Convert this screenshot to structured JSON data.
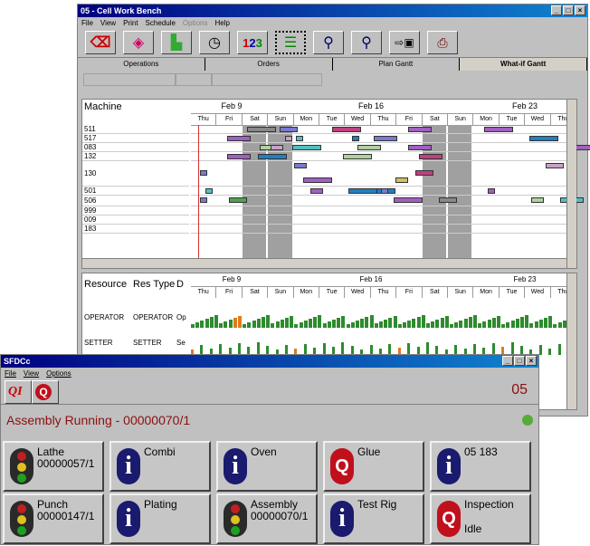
{
  "workbench": {
    "title": "05 - Cell Work Bench",
    "menu": [
      "File",
      "View",
      "Print",
      "Schedule",
      "Options",
      "Help"
    ],
    "tabs": [
      "Operations",
      "Orders",
      "Plan Gantt",
      "What-if Gantt"
    ],
    "header_col": "Machine",
    "weeks": [
      "Feb 9",
      "Feb 16",
      "Feb 23"
    ],
    "days": [
      "Thu",
      "Fri",
      "Sat",
      "Sun",
      "Mon",
      "Tue",
      "Wed",
      "Thu",
      "Fri",
      "Sat",
      "Sun",
      "Mon",
      "Tue",
      "Wed",
      "Thu"
    ],
    "machines": [
      "511",
      "517",
      "083",
      "132",
      "130",
      "501",
      "506",
      "999",
      "009",
      "183"
    ],
    "resource_headers": [
      "Resource",
      "Res Type",
      "D"
    ],
    "resources": [
      {
        "name": "OPERATOR",
        "type": "OPERATOR",
        "d": "Op"
      },
      {
        "name": "SETTER",
        "type": "SETTER",
        "d": "Se"
      }
    ],
    "colors": {
      "accent": "#1a1a8c",
      "chart_green": "#2e8b2e",
      "chart_orange": "#e07a1c"
    }
  },
  "sfdc": {
    "title": "SFDCc",
    "menu": [
      "File",
      "View",
      "Options"
    ],
    "cell_number": "05",
    "status_line": "Assembly Running - 00000070/1",
    "status_color": "#5aaa3a",
    "buttons": [
      {
        "label": "Lathe",
        "sub": "00000057/1",
        "icon": "traffic-light-icon"
      },
      {
        "label": "Combi",
        "sub": "",
        "icon": "info-icon"
      },
      {
        "label": "Oven",
        "sub": "",
        "icon": "info-icon"
      },
      {
        "label": "Glue",
        "sub": "",
        "icon": "quality-icon"
      },
      {
        "label": "05 183",
        "sub": "",
        "icon": "info-icon"
      },
      {
        "label": "Punch",
        "sub": "00000147/1",
        "icon": "traffic-light-icon"
      },
      {
        "label": "Plating",
        "sub": "",
        "icon": "info-icon"
      },
      {
        "label": "Assembly",
        "sub": "00000070/1",
        "icon": "traffic-light-icon"
      },
      {
        "label": "Test Rig",
        "sub": "",
        "icon": "info-icon"
      },
      {
        "label": "Inspection",
        "sub": "Idle",
        "icon": "quality-icon"
      }
    ]
  }
}
